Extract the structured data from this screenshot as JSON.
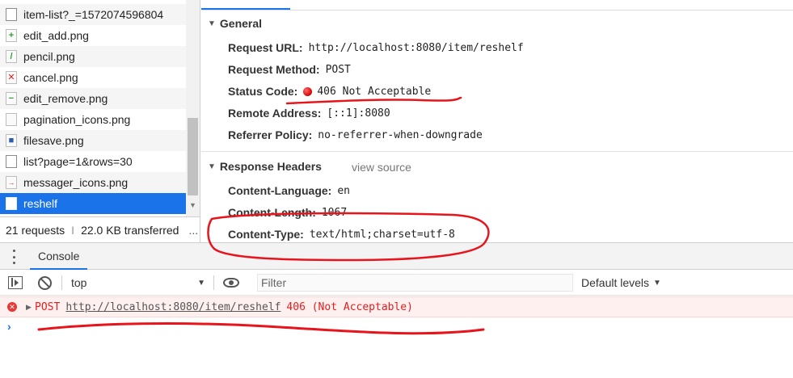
{
  "network": {
    "requests": [
      {
        "name": "item-list?_=1572074596804",
        "icon": "document-icon"
      },
      {
        "name": "edit_add.png",
        "icon": "add-image-icon"
      },
      {
        "name": "pencil.png",
        "icon": "pencil-image-icon"
      },
      {
        "name": "cancel.png",
        "icon": "cancel-image-icon"
      },
      {
        "name": "edit_remove.png",
        "icon": "remove-image-icon"
      },
      {
        "name": "pagination_icons.png",
        "icon": "image-icon"
      },
      {
        "name": "filesave.png",
        "icon": "save-image-icon"
      },
      {
        "name": "list?page=1&rows=30",
        "icon": "document-icon"
      },
      {
        "name": "messager_icons.png",
        "icon": "image-icon"
      },
      {
        "name": "reshelf",
        "icon": "document-icon",
        "selected": true
      }
    ],
    "summary": {
      "requests": "21 requests",
      "separator": "I",
      "transferred": "22.0 KB transferred",
      "more": "..."
    }
  },
  "details": {
    "general": {
      "title": "General",
      "request_url_label": "Request URL:",
      "request_url": "http://localhost:8080/item/reshelf",
      "request_method_label": "Request Method:",
      "request_method": "POST",
      "status_code_label": "Status Code:",
      "status_code": "406 Not Acceptable",
      "remote_address_label": "Remote Address:",
      "remote_address": "[::1]:8080",
      "referrer_policy_label": "Referrer Policy:",
      "referrer_policy": "no-referrer-when-downgrade"
    },
    "response_headers": {
      "title": "Response Headers",
      "view_source": "view source",
      "content_language_label": "Content-Language:",
      "content_language": "en",
      "content_length_label": "Content-Length:",
      "content_length": "1067",
      "content_type_label": "Content-Type:",
      "content_type": "text/html;charset=utf-8"
    }
  },
  "console": {
    "tab_label": "Console",
    "context": "top",
    "filter_placeholder": "Filter",
    "levels": "Default levels",
    "error": {
      "method": "POST",
      "url": "http://localhost:8080/item/reshelf",
      "status": "406 (Not Acceptable)"
    },
    "prompt": "›"
  },
  "colors": {
    "accent": "#1a73e8",
    "error_text": "#e02020",
    "annotation_red": "#e8141c"
  }
}
